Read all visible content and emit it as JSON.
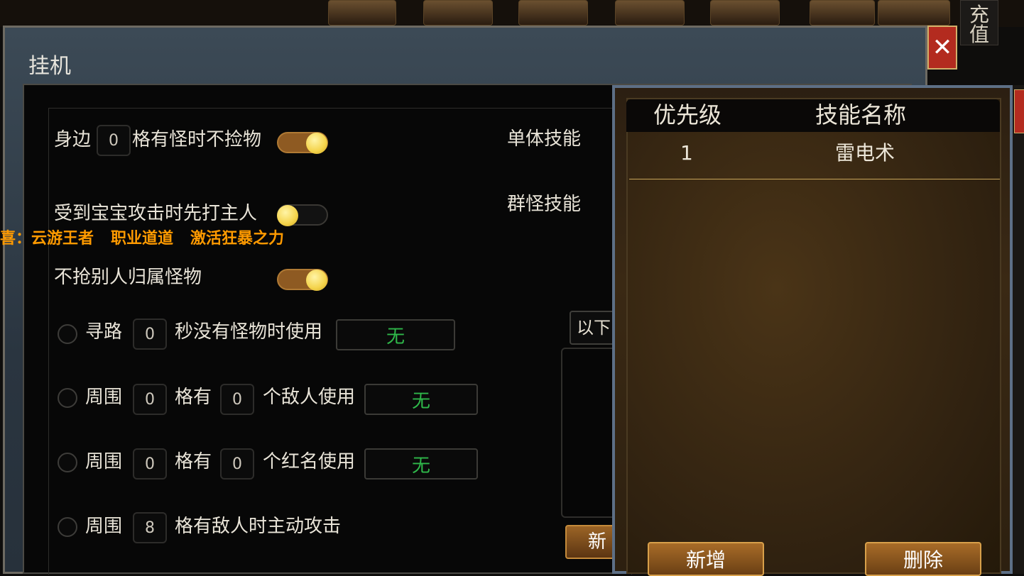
{
  "topbar": {
    "recharge_label": "充\n值"
  },
  "window": {
    "title": "挂机",
    "close_glyph": "✕"
  },
  "announce": {
    "prefix": "喜：",
    "items": [
      "云游王者",
      "职业道道",
      "激活狂暴之力"
    ]
  },
  "settings": {
    "no_pickup": {
      "pre": "身边",
      "value": "0",
      "post": "格有怪时不捡物",
      "enabled": true
    },
    "hit_master": {
      "label": "受到宝宝攻击时先打主人",
      "enabled": false
    },
    "no_steal": {
      "label": "不抢别人归属怪物",
      "enabled": true
    },
    "pathfind": {
      "pre": "寻路",
      "value": "0",
      "post": "秒没有怪物时使用",
      "skill": "无",
      "checked": false
    },
    "enemies": {
      "pre": "周围",
      "range": "0",
      "mid": "格有",
      "count": "0",
      "post": "个敌人使用",
      "skill": "无",
      "checked": false
    },
    "rednames": {
      "pre": "周围",
      "range": "0",
      "mid": "格有",
      "count": "0",
      "post": "个红名使用",
      "skill": "无",
      "checked": false
    },
    "auto_attack": {
      "pre": "周围",
      "range": "8",
      "post": "格有敌人时主动攻击",
      "checked": false
    }
  },
  "skills": {
    "single_label": "单体技能",
    "group_label": "群怪技能",
    "dropdown_value": "以下",
    "new_button": "新增"
  },
  "popup": {
    "columns": [
      "优先级",
      "技能名称"
    ],
    "rows": [
      {
        "priority": "1",
        "name": "雷电术"
      }
    ],
    "add_button": "新增",
    "delete_button": "删除"
  },
  "colors": {
    "accent_orange": "#ff9a00",
    "skill_green": "#2fb84a",
    "close_red": "#b32b1f"
  }
}
